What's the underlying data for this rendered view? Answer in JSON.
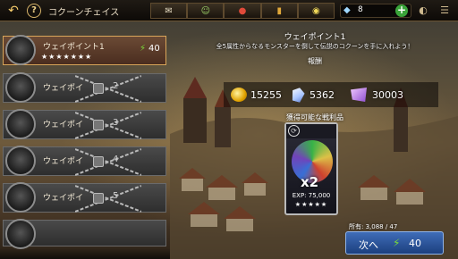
{
  "header": {
    "title": "コクーンチェイス",
    "back_icon": "back-arrow-icon",
    "help_label": "?",
    "tabs": [
      {
        "icon": "mail-icon"
      },
      {
        "icon": "friends-icon"
      },
      {
        "icon": "gift-icon"
      },
      {
        "icon": "bookmark-icon"
      },
      {
        "icon": "chat-icon"
      }
    ],
    "gems": "8",
    "plus_label": "+"
  },
  "waypoints": [
    {
      "label": "ウェイポイント1",
      "stars": "★★★★★★★",
      "energy": "40",
      "selected": true,
      "locked": false
    },
    {
      "label": "ウェイポイ",
      "lock_num": "2",
      "locked": true
    },
    {
      "label": "ウェイポイ",
      "lock_num": "3",
      "locked": true
    },
    {
      "label": "ウェイポイ",
      "lock_num": "4",
      "locked": true
    },
    {
      "label": "ウェイポイ",
      "lock_num": "5",
      "locked": true
    }
  ],
  "detail": {
    "title": "ウェイポイント1",
    "description": "全5属性からなるモンスターを倒して伝説のコクーンを手に入れよう！",
    "reward_label": "報酬",
    "rewards": {
      "coins": "15255",
      "crystals": "5362",
      "badges": "30003"
    },
    "drop_label": "獲得可能な戦利品",
    "card": {
      "multiplier": "x2",
      "exp": "EXP: 75,000",
      "stars": "★★★★★"
    },
    "owned": "所有: 3,088 / 47",
    "next_label": "次へ",
    "next_cost": "40"
  },
  "colors": {
    "accent_green": "#7adb3a",
    "button_blue": "#2c56a0",
    "selected_row": "#5a3a28"
  }
}
